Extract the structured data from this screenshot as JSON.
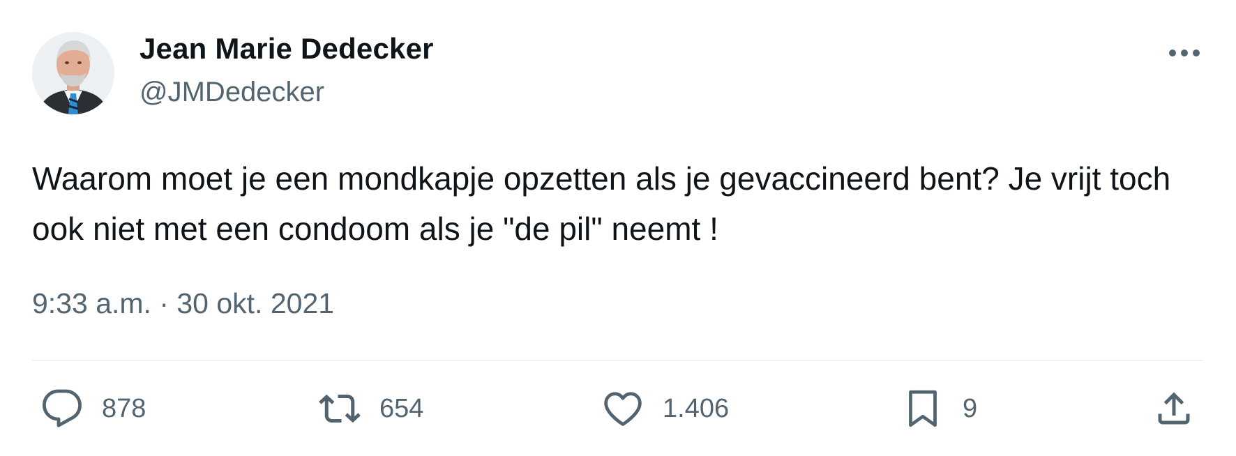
{
  "author": {
    "display_name": "Jean Marie Dedecker",
    "handle": "@JMDedecker"
  },
  "tweet": {
    "text": "Waarom moet je een mondkapje opzetten als je gevaccineerd bent? Je vrijt toch ook niet met een condoom als je \"de pil\" neemt !",
    "timestamp": "9:33 a.m. · 30 okt. 2021"
  },
  "actions": {
    "reply_count": "878",
    "retweet_count": "654",
    "like_count": "1.406",
    "bookmark_count": "9"
  },
  "icons": {
    "more": "more-horizontal-icon",
    "reply": "reply-icon",
    "retweet": "retweet-icon",
    "like": "heart-icon",
    "bookmark": "bookmark-icon",
    "share": "share-icon"
  },
  "colors": {
    "text_primary": "#0f1419",
    "text_secondary": "#536471",
    "divider": "#eff3f4"
  }
}
